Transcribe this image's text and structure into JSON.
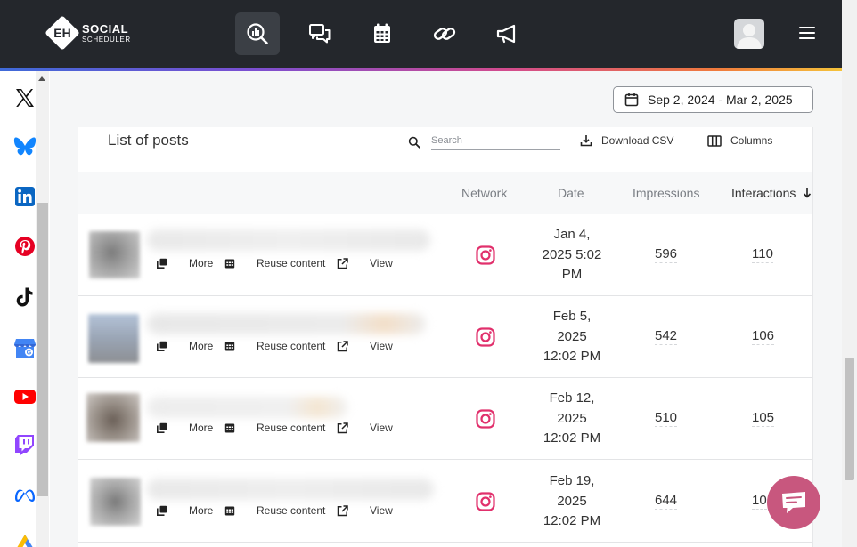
{
  "app": {
    "logo_initials": "EH",
    "logo_line1": "SOCIAL",
    "logo_line2": "SCHEDULER"
  },
  "nav": {
    "items": [
      {
        "name": "analytics-icon",
        "active": true
      },
      {
        "name": "messages-icon",
        "active": false
      },
      {
        "name": "calendar-icon",
        "active": false
      },
      {
        "name": "link-icon",
        "active": false
      },
      {
        "name": "megaphone-icon",
        "active": false
      }
    ]
  },
  "sidebar": {
    "networks": [
      "x",
      "bluesky",
      "linkedin",
      "pinterest",
      "tiktok",
      "google-business",
      "youtube",
      "twitch",
      "meta",
      "google-ads"
    ]
  },
  "date_range": {
    "label": "Sep 2, 2024 - Mar 2, 2025"
  },
  "posts": {
    "title": "List of posts",
    "search_placeholder": "Search",
    "download_label": "Download CSV",
    "columns_label": "Columns",
    "headers": {
      "network": "Network",
      "date": "Date",
      "impressions": "Impressions",
      "interactions": "Interactions",
      "sort_direction": "descending"
    },
    "actions": {
      "more": "More",
      "reuse": "Reuse content",
      "view": "View"
    },
    "rows": [
      {
        "network": "instagram",
        "date_lines": [
          "Jan 4,",
          "2025 5:02",
          "PM"
        ],
        "impressions": "596",
        "interactions": "110"
      },
      {
        "network": "instagram",
        "date_lines": [
          "Feb 5,",
          "2025",
          "12:02 PM"
        ],
        "impressions": "542",
        "interactions": "106"
      },
      {
        "network": "instagram",
        "date_lines": [
          "Feb 12,",
          "2025",
          "12:02 PM"
        ],
        "impressions": "510",
        "interactions": "105"
      },
      {
        "network": "instagram",
        "date_lines": [
          "Feb 19,",
          "2025",
          "12:02 PM"
        ],
        "impressions": "644",
        "interactions": "10"
      }
    ]
  },
  "colors": {
    "topbar": "#24272c",
    "instagram": "#e1306c",
    "chat": "#c8577e"
  }
}
